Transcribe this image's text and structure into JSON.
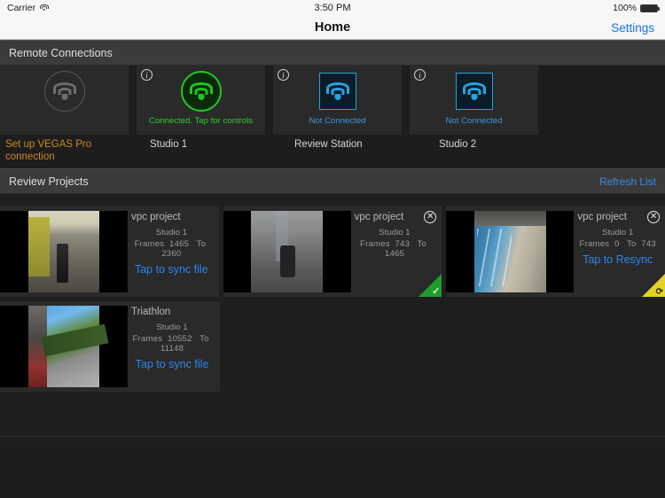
{
  "status_bar": {
    "carrier": "Carrier",
    "wifi_icon": "wifi-icon",
    "time": "3:50 PM",
    "battery_percent": "100%",
    "battery_icon": "battery-full-icon"
  },
  "nav_bar": {
    "title": "Home",
    "settings_label": "Settings"
  },
  "remote_connections": {
    "header": "Remote Connections",
    "tiles": [
      {
        "status_text": "",
        "label": "Set up VEGAS Pro connection",
        "label_style": "warn",
        "icon": "wifi-icon",
        "icon_style": "grey-circle",
        "has_info_badge": false,
        "info_badge_icon": ""
      },
      {
        "status_text": "Connected. Tap for controls",
        "label": "Studio 1",
        "label_style": "normal",
        "icon": "wifi-icon",
        "icon_style": "green-circle",
        "has_info_badge": true,
        "info_badge_icon": "info-icon"
      },
      {
        "status_text": "Not Connected",
        "label": "Review Station",
        "label_style": "normal",
        "icon": "wifi-icon",
        "icon_style": "blue-square",
        "has_info_badge": true,
        "info_badge_icon": "info-icon"
      },
      {
        "status_text": "Not Connected",
        "label": "Studio 2",
        "label_style": "normal",
        "icon": "wifi-icon",
        "icon_style": "blue-square",
        "has_info_badge": true,
        "info_badge_icon": "info-icon"
      }
    ]
  },
  "review_projects": {
    "header": "Review Projects",
    "refresh_label": "Refresh List",
    "frames_label": "Frames",
    "to_label": "To",
    "cards": [
      {
        "name": "vpc project",
        "studio": "Studio 1",
        "frame_from": "1465",
        "frame_to": "2360",
        "action": "Tap to sync file",
        "has_close": false,
        "close_icon": "",
        "badge": "none",
        "badge_icon": "",
        "scene": "scene-gym"
      },
      {
        "name": "vpc project",
        "studio": "Studio 1",
        "frame_from": "743",
        "frame_to": "1465",
        "action": "",
        "has_close": true,
        "close_icon": "close-icon",
        "badge": "ok",
        "badge_icon": "check-icon",
        "scene": "scene-bike"
      },
      {
        "name": "vpc project",
        "studio": "Studio 1",
        "frame_from": "0",
        "frame_to": "743",
        "action": "Tap to Resync",
        "has_close": true,
        "close_icon": "close-icon",
        "badge": "warn",
        "badge_icon": "resync-icon",
        "scene": "scene-pool"
      },
      {
        "name": "Triathlon",
        "studio": "Studio 1",
        "frame_from": "10552",
        "frame_to": "11148",
        "action": "Tap to sync file",
        "has_close": false,
        "close_icon": "",
        "badge": "none",
        "badge_icon": "",
        "scene": "scene-road"
      }
    ]
  },
  "colors": {
    "accent_blue": "#2b86f0",
    "connected_green": "#2fcd2f",
    "not_connected_blue": "#3b97e0",
    "warn_orange": "#cf8a1c",
    "badge_ok": "#1f9c2c",
    "badge_warn": "#e3d325"
  }
}
